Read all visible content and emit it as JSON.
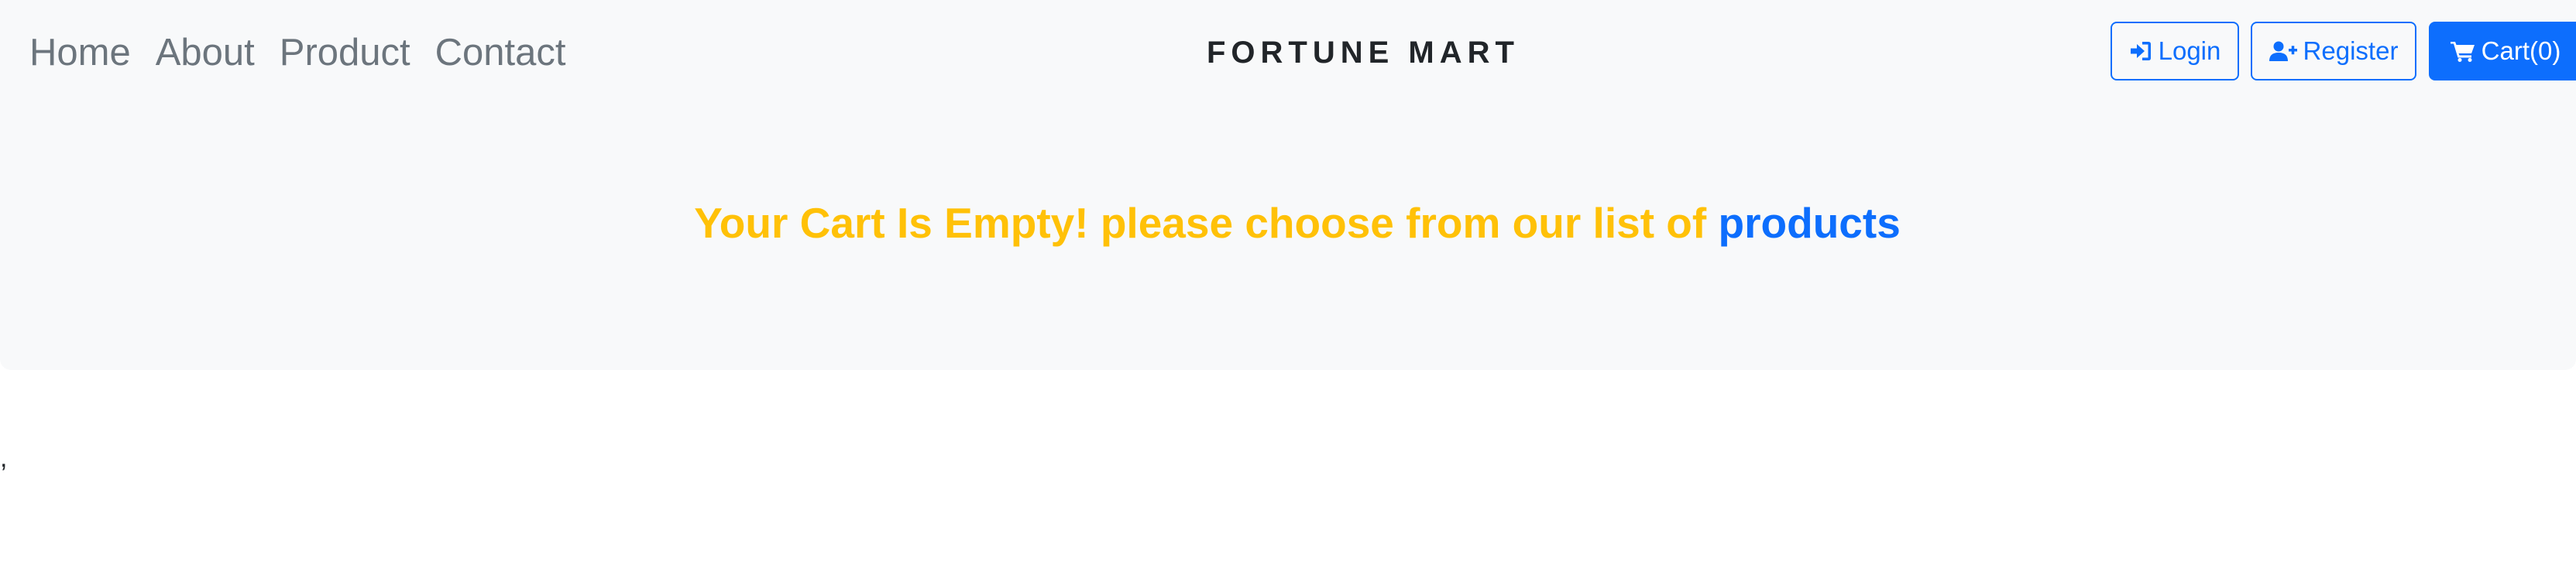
{
  "nav": {
    "links": [
      "Home",
      "About",
      "Product",
      "Contact"
    ]
  },
  "brand": "FORTUNE MART",
  "actions": {
    "login_label": "Login",
    "register_label": "Register",
    "cart_label": "Cart(0)",
    "login_icon": "sign-in-icon",
    "register_icon": "user-plus-icon",
    "cart_icon": "cart-icon"
  },
  "cart_message": {
    "text": "Your Cart Is Empty! please choose from our list of",
    "link": "products"
  },
  "stray_text": ",",
  "colors": {
    "panel_bg": "#f8f9fa",
    "accent": "#0d6efd",
    "warning": "#ffc107",
    "nav_text": "#6c757d",
    "brand_text": "#212529"
  }
}
